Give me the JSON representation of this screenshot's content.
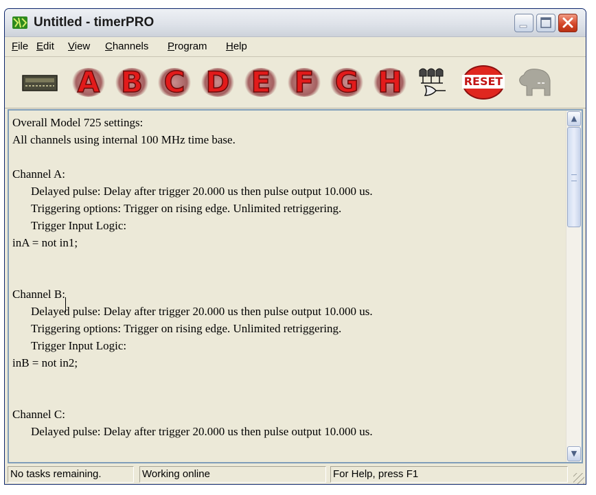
{
  "window": {
    "app_icon": "timerpro-app-icon",
    "title": "Untitled - timerPRO",
    "controls": [
      "minimize-icon",
      "maximize-icon",
      "close-icon"
    ]
  },
  "menu": [
    {
      "accel": "F",
      "rest": "ile"
    },
    {
      "accel": "E",
      "rest": "dit"
    },
    {
      "accel": "V",
      "rest": "iew"
    },
    {
      "accel": "C",
      "rest": "hannels"
    },
    {
      "accel": "P",
      "rest": "rogram"
    },
    {
      "accel": "H",
      "rest": "elp"
    }
  ],
  "toolbar": {
    "device_icon": "device-module-icon",
    "channels": [
      "A",
      "B",
      "C",
      "D",
      "E",
      "F",
      "G",
      "H"
    ],
    "logic_icon": "logic-gates-icon",
    "reset_label": "RESET",
    "elephant_icon": "elephant-icon"
  },
  "document": {
    "lines": [
      {
        "text": "Overall Model 725 settings:",
        "indent": false
      },
      {
        "text": "All channels using internal 100 MHz time base.",
        "indent": false
      },
      {
        "text": "",
        "indent": false
      },
      {
        "text": "Channel A:",
        "indent": false
      },
      {
        "text": "Delayed pulse: Delay after trigger 20.000 us then pulse output 10.000 us.",
        "indent": true
      },
      {
        "text": "Triggering options: Trigger on rising edge. Unlimited retriggering.",
        "indent": true
      },
      {
        "text": "Trigger Input Logic:",
        "indent": true
      },
      {
        "text": "inA = not in1;",
        "indent": false
      },
      {
        "text": "",
        "indent": false
      },
      {
        "text": "",
        "indent": false
      },
      {
        "text": "Channel B:",
        "indent": false
      },
      {
        "text": "Delayed pulse: Delay after trigger 20.000 us then pulse output 10.000 us.",
        "indent": true
      },
      {
        "text": "Triggering options: Trigger on rising edge. Unlimited retriggering.",
        "indent": true
      },
      {
        "text": "Trigger Input Logic:",
        "indent": true
      },
      {
        "text": "inB = not in2;",
        "indent": false
      },
      {
        "text": "",
        "indent": false
      },
      {
        "text": "",
        "indent": false
      },
      {
        "text": "Channel C:",
        "indent": false
      },
      {
        "text": "Delayed pulse: Delay after trigger 20.000 us then pulse output 10.000 us.",
        "indent": true
      }
    ]
  },
  "scrollbar": {
    "up_icon": "scroll-up-icon",
    "down_icon": "scroll-down-icon"
  },
  "status": {
    "tasks": "No tasks remaining.",
    "connection": "Working online",
    "help": "For Help, press F1"
  }
}
